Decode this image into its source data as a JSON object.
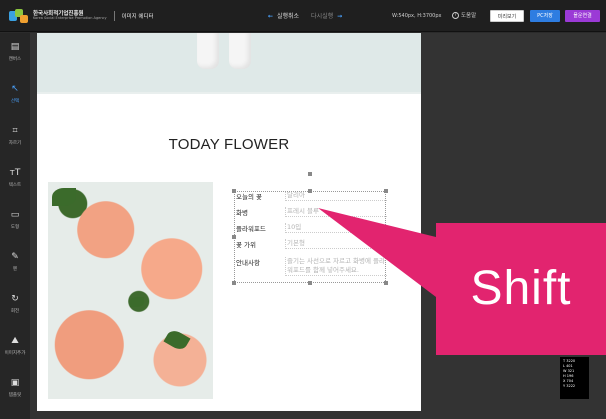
{
  "topbar": {
    "org_name": "한국사회적기업진흥원",
    "org_sub": "Korea Social Enterprise Promotion Agency",
    "app_name": "이미지 에디터",
    "undo_label": "실행취소",
    "redo_label": "다시실행",
    "canvas_size": "W:540px, H:3700px",
    "help_label": "도움말",
    "preview_label": "미리보기",
    "pc_save_label": "PC저장",
    "mobile_label": "몰운연결"
  },
  "sidebar": {
    "items": [
      {
        "label": "캔버스",
        "icon": "canvas-icon"
      },
      {
        "label": "선택",
        "icon": "select-icon",
        "active": true
      },
      {
        "label": "자르기",
        "icon": "crop-icon"
      },
      {
        "label": "텍스트",
        "icon": "text-icon"
      },
      {
        "label": "도형",
        "icon": "shape-icon"
      },
      {
        "label": "펜",
        "icon": "pen-icon"
      },
      {
        "label": "회전",
        "icon": "rotate-icon"
      },
      {
        "label": "이미지추가",
        "icon": "add-image-icon"
      },
      {
        "label": "템플릿",
        "icon": "template-icon"
      }
    ]
  },
  "page": {
    "title": "TODAY FLOWER",
    "info_rows": [
      {
        "key": "오늘의 꽃",
        "value": "달리아"
      },
      {
        "key": "화병",
        "value": "프레시 블루"
      },
      {
        "key": "플라워포드",
        "value": "10입"
      },
      {
        "key": "꽃 가위",
        "value": "기본형"
      },
      {
        "key": "안내사항",
        "value": "즐기는 사선으로 자르고 화병에 플라워포드를 함께 넣어주세요."
      }
    ]
  },
  "overlay": {
    "shift_label": "Shift"
  },
  "readout": {
    "lines": [
      "T 3220",
      "L 401",
      "W 321",
      "H 196",
      "X 704",
      "Y 3222"
    ]
  },
  "colors": {
    "accent": "#2e7de1",
    "mobile_button": "#9b3ad6",
    "shift_badge": "#e2246f",
    "topbar_bg": "#1f1f1f",
    "sidebar_bg": "#262626"
  }
}
